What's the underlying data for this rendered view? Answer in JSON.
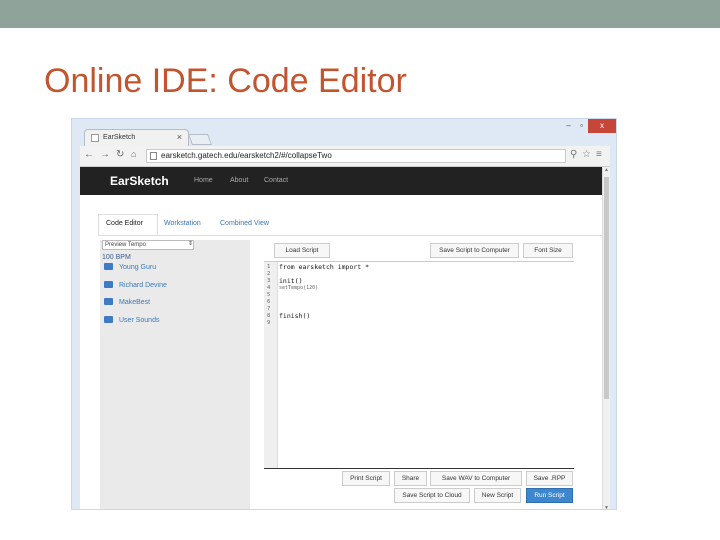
{
  "slide": {
    "title": "Online IDE: Code Editor"
  },
  "browser": {
    "tab_title": "EarSketch",
    "tab_close": "×",
    "url": "earsketch.gatech.edu/earsketch2/#/collapseTwo",
    "win_min": "–",
    "win_max": "▫",
    "win_close": "x"
  },
  "app": {
    "brand": "EarSketch",
    "nav": [
      "Home",
      "About",
      "Contact"
    ],
    "tabs": [
      "Code Editor",
      "Workstation",
      "Combined View"
    ],
    "tempo_placeholder": "Preview Tempo",
    "bpm": "100 BPM",
    "folders": [
      "Young Guru",
      "Richard Devine",
      "MakeBest",
      "User Sounds"
    ],
    "top_buttons": {
      "load": "Load Script",
      "save_computer": "Save Script to Computer",
      "font": "Font Size"
    },
    "code_lines": [
      {
        "n": "1",
        "text": "from earsketch import *"
      },
      {
        "n": "2",
        "text": ""
      },
      {
        "n": "3",
        "text": "init()"
      },
      {
        "n": "4",
        "text": "setTempo(120)"
      },
      {
        "n": "5",
        "text": ""
      },
      {
        "n": "6",
        "text": ""
      },
      {
        "n": "7",
        "text": ""
      },
      {
        "n": "8",
        "text": "finish()"
      },
      {
        "n": "9",
        "text": ""
      }
    ],
    "bottom_buttons": {
      "print": "Print Script",
      "share": "Share",
      "save_wav": "Save WAV to Computer",
      "save_rpp": "Save .RPP",
      "save_cloud": "Save Script to Cloud",
      "new_script": "New Script",
      "run": "Run Script"
    }
  },
  "colors": {
    "slide_title": "#c2542f",
    "topbar": "#8fa39a",
    "nav_bg": "#222222",
    "primary": "#3d87cf"
  }
}
